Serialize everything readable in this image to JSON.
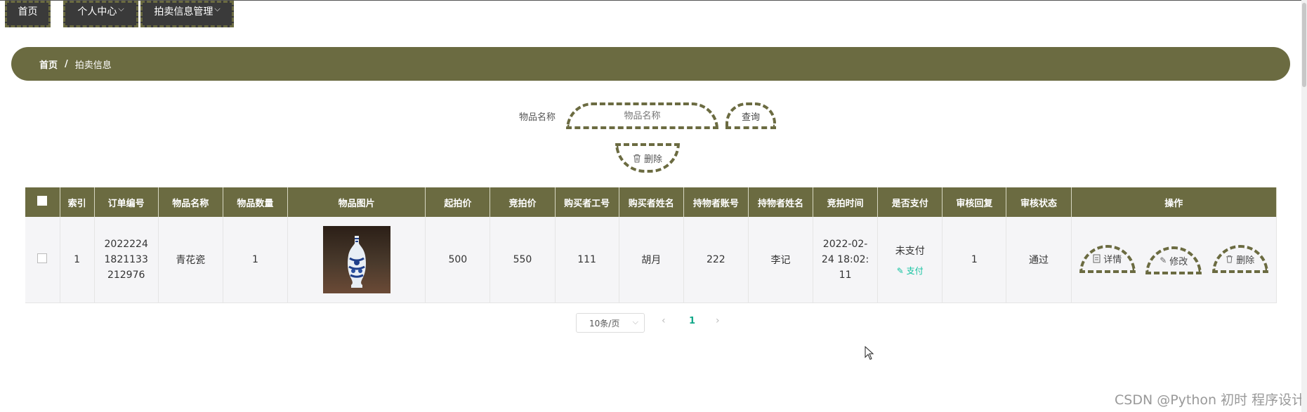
{
  "nav": {
    "home": "首页",
    "personal": "个人中心",
    "auction_mgmt": "拍卖信息管理"
  },
  "breadcrumb": {
    "home": "首页",
    "separator": "/",
    "current": "拍卖信息"
  },
  "search": {
    "label": "物品名称",
    "placeholder": "物品名称",
    "query_button": "查询"
  },
  "bulk_delete_button": "删除",
  "table": {
    "headers": {
      "index": "索引",
      "order_no": "订单编号",
      "item_name": "物品名称",
      "item_qty": "物品数量",
      "item_image": "物品图片",
      "start_price": "起拍价",
      "bid_price": "竞拍价",
      "buyer_id": "购买者工号",
      "buyer_name": "购买者姓名",
      "holder_account": "持物者账号",
      "holder_name": "持物者姓名",
      "bid_time": "竞拍时间",
      "is_paid": "是否支付",
      "review_reply": "审核回复",
      "review_status": "审核状态",
      "actions": "操作"
    },
    "rows": [
      {
        "index": "1",
        "order_no": "2022224182113321 2976",
        "order_no_display": "20222241821133212976",
        "item_name": "青花瓷",
        "item_qty": "1",
        "start_price": "500",
        "bid_price": "550",
        "buyer_id": "111",
        "buyer_name": "胡月",
        "holder_account": "222",
        "holder_name": "李记",
        "bid_time": "2022-02-24 18:02:11",
        "is_paid": "未支付",
        "pay_link": "支付",
        "review_reply": "1",
        "review_status": "通过",
        "actions": {
          "detail": "详情",
          "edit": "修改",
          "delete": "删除"
        }
      }
    ]
  },
  "pagination": {
    "page_size": "10条/页",
    "current_page": "1"
  },
  "watermark": "CSDN @Python 初时 程序设计",
  "colors": {
    "primary": "#6b6b41",
    "nav_bg": "#3a3a3a",
    "link": "#13c2a0"
  }
}
